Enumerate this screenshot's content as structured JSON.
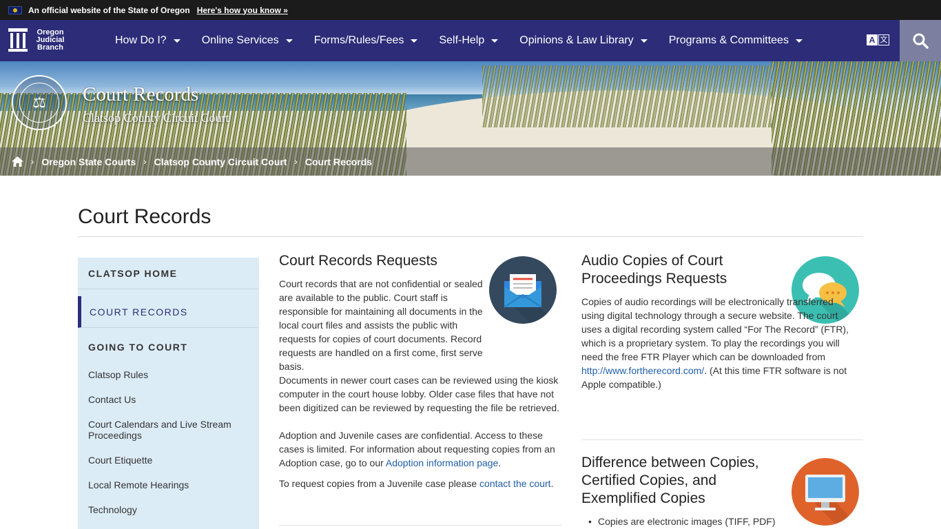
{
  "official_banner": {
    "text": "An official website of the State of Oregon",
    "link": "Here's how you know »"
  },
  "logo": {
    "line1": "Oregon",
    "line2": "Judicial",
    "line3": "Branch"
  },
  "nav": {
    "items": [
      {
        "label": "How Do I?"
      },
      {
        "label": "Online Services"
      },
      {
        "label": "Forms/Rules/Fees"
      },
      {
        "label": "Self-Help"
      },
      {
        "label": "Opinions & Law Library"
      },
      {
        "label": "Programs & Committees"
      }
    ],
    "translate_a": "A",
    "translate_b": "文"
  },
  "hero": {
    "title": "Court Records",
    "subtitle": "Clatsop County Circuit Court",
    "seal_text": "⚖"
  },
  "breadcrumb": {
    "items": [
      {
        "label": "Oregon State Courts"
      },
      {
        "label": "Clatsop County Circuit Court"
      },
      {
        "label": "Court Records"
      }
    ],
    "separator": "›"
  },
  "page": {
    "title": "Court Records"
  },
  "sidebar": {
    "heads": [
      {
        "label": "CLATSOP HOME"
      },
      {
        "label": "COURT RECORDS"
      },
      {
        "label": "GOING TO COURT"
      }
    ],
    "links": [
      {
        "label": "Clatsop Rules"
      },
      {
        "label": "Contact Us"
      },
      {
        "label": "Court Calendars and Live Stream Proceedings"
      },
      {
        "label": "Court Etiquette"
      },
      {
        "label": "Local Remote Hearings"
      },
      {
        "label": "Technology"
      }
    ]
  },
  "records_requests": {
    "heading": "Court Records Requests",
    "p1": "Court records that are not confidential or sealed are available to the public. Court staff is responsible for maintaining all documents in the local court files and assists the public with requests for copies of court documents. Record requests are handled on a first come, first serve basis.",
    "p2": "Documents in newer court cases can be reviewed using the kiosk computer in the court house lobby. Older case files that have not been digitized can be reviewed by requesting the file be retrieved.",
    "p3_text": "Adoption and Juvenile cases are confidential. Access to these cases is limited. For information about requesting copies from an Adoption case, go to our ",
    "p3_link": "Adoption information page",
    "p3_end": ".",
    "p4_text": "To request copies from a Juvenile case please ",
    "p4_link": "contact the court",
    "p4_end": "."
  },
  "audio_copies": {
    "heading": "Audio Copies of Court Proceedings Requests",
    "p1_text": "Copies of audio recordings will be electronically transferred using digital technology through a secure website. The court uses a digital recording system called “For The Record” (FTR), which is a proprietary system. To play the recordings you will need the free FTR Player which can be downloaded from ",
    "p1_link": "http://www.fortherecord.com/",
    "p1_end": ". (At this time FTR software is not Apple compatible.)"
  },
  "copies_diff": {
    "heading": "Difference between Copies, Certified Copies, and Exemplified Copies",
    "bullet1": "Copies are electronic images (TIFF, PDF)"
  },
  "colors": {
    "nav_bg": "#2c2c79",
    "sidebar_bg": "#dcecf7",
    "link": "#1f5ea8",
    "icon_envelope_bg": "#34495e",
    "icon_chat_bg": "#3bbfb2",
    "icon_monitor_bg": "#e0622b"
  }
}
